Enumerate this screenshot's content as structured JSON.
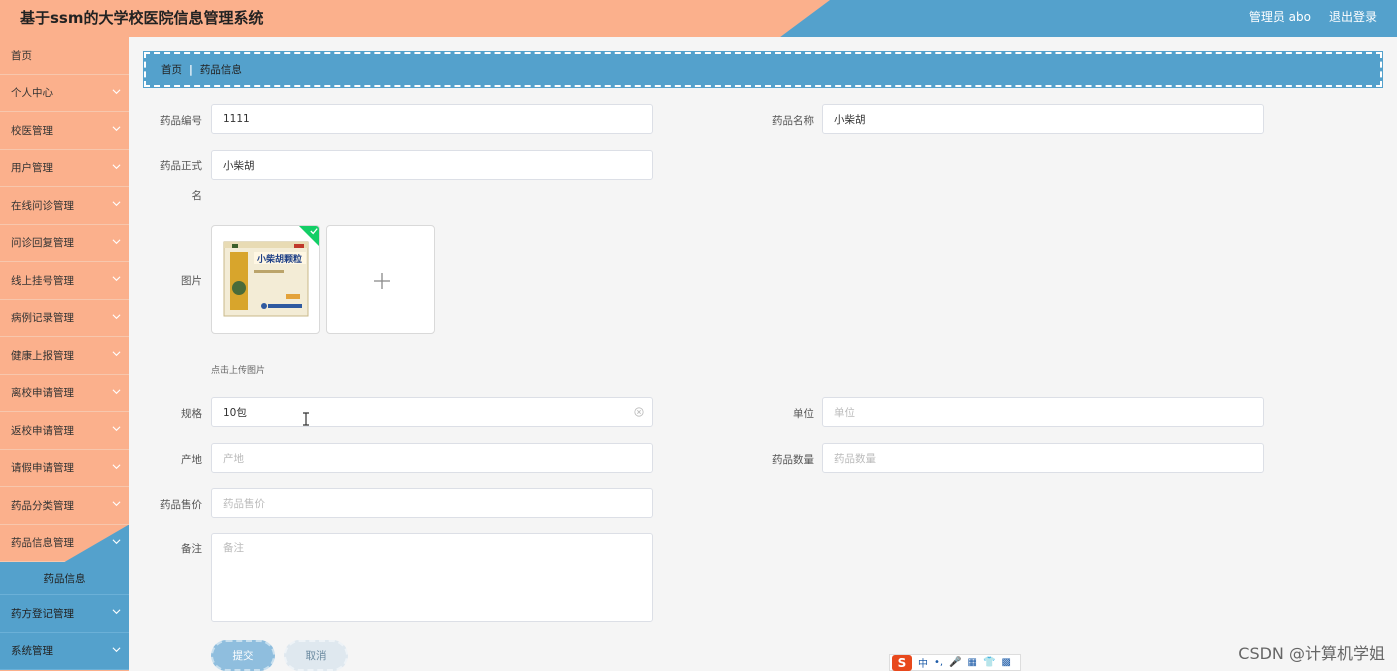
{
  "header": {
    "title": "基于ssm的大学校医院信息管理系统",
    "user": "管理员 abo",
    "logout": "退出登录"
  },
  "sidebar": {
    "items": [
      {
        "label": "首页"
      },
      {
        "label": "个人中心"
      },
      {
        "label": "校医管理"
      },
      {
        "label": "用户管理"
      },
      {
        "label": "在线问诊管理"
      },
      {
        "label": "问诊回复管理"
      },
      {
        "label": "线上挂号管理"
      },
      {
        "label": "病例记录管理"
      },
      {
        "label": "健康上报管理"
      },
      {
        "label": "离校申请管理"
      },
      {
        "label": "返校申请管理"
      },
      {
        "label": "请假申请管理"
      },
      {
        "label": "药品分类管理"
      },
      {
        "label": "药品信息管理"
      }
    ],
    "submenu": {
      "label": "药品信息"
    },
    "after_items": [
      {
        "label": "药方登记管理"
      },
      {
        "label": "系统管理"
      }
    ]
  },
  "breadcrumb": {
    "home": "首页",
    "separator": "|",
    "current": "药品信息"
  },
  "form": {
    "drug_code": {
      "label": "药品编号",
      "value": "1111"
    },
    "drug_name": {
      "label": "药品名称",
      "value": "小柴胡"
    },
    "formal_name": {
      "label_line1": "药品正式",
      "label_line2": "名",
      "value": "小柴胡"
    },
    "image": {
      "label": "图片",
      "hint": "点击上传图片",
      "product_text": "小柴胡颗粒"
    },
    "spec": {
      "label": "规格",
      "value": "10包"
    },
    "unit": {
      "label": "单位",
      "placeholder": "单位"
    },
    "origin": {
      "label": "产地",
      "placeholder": "产地"
    },
    "quantity": {
      "label": "药品数量",
      "placeholder": "药品数量"
    },
    "price": {
      "label": "药品售价",
      "placeholder": "药品售价"
    },
    "remark": {
      "label": "备注",
      "placeholder": "备注"
    }
  },
  "buttons": {
    "submit": "提交",
    "cancel": "取消"
  },
  "ime": {
    "logo": "S",
    "mode": "中"
  },
  "watermark": "CSDN @计算机学姐",
  "colors": {
    "accent_orange": "#fbb08c",
    "accent_blue": "#54a1cc",
    "upload_success": "#13ce66"
  }
}
